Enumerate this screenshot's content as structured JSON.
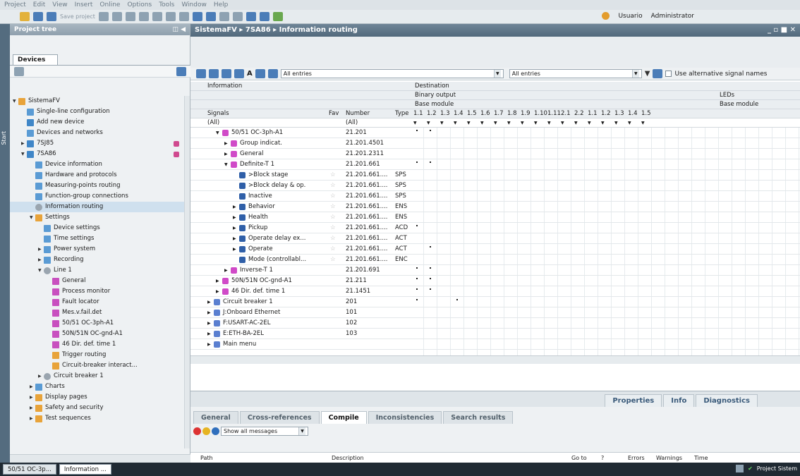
{
  "menu": [
    "Project",
    "Edit",
    "View",
    "Insert",
    "Online",
    "Options",
    "Tools",
    "Window",
    "Help"
  ],
  "toolbar": {
    "save_project": "Save project"
  },
  "user": {
    "name": "Usuario",
    "role": "Administrator"
  },
  "start_label": "Start",
  "tree": {
    "title": "Project tree",
    "tab": "Devices",
    "items": [
      {
        "label": "SistemaFV",
        "indent": 0,
        "tri": "down"
      },
      {
        "label": "Single-line configuration",
        "indent": 1
      },
      {
        "label": "Add new device",
        "indent": 1
      },
      {
        "label": "Devices and networks",
        "indent": 1
      },
      {
        "label": "7SJ85",
        "indent": 1,
        "tri": "right",
        "mark": true
      },
      {
        "label": "7SA86",
        "indent": 1,
        "tri": "down",
        "mark": true
      },
      {
        "label": "Device information",
        "indent": 2
      },
      {
        "label": "Hardware and protocols",
        "indent": 2
      },
      {
        "label": "Measuring-points routing",
        "indent": 2
      },
      {
        "label": "Function-group connections",
        "indent": 2
      },
      {
        "label": "Information routing",
        "indent": 2,
        "selected": true
      },
      {
        "label": "Settings",
        "indent": 2,
        "tri": "down"
      },
      {
        "label": "Device settings",
        "indent": 3
      },
      {
        "label": "Time settings",
        "indent": 3
      },
      {
        "label": "Power system",
        "indent": 3,
        "tri": "right"
      },
      {
        "label": "Recording",
        "indent": 3,
        "tri": "right"
      },
      {
        "label": "Line 1",
        "indent": 3,
        "tri": "down"
      },
      {
        "label": "General",
        "indent": 4
      },
      {
        "label": "Process monitor",
        "indent": 4
      },
      {
        "label": "Fault locator",
        "indent": 4
      },
      {
        "label": "Mes.v.fail.det",
        "indent": 4
      },
      {
        "label": "50/51 OC-3ph-A1",
        "indent": 4
      },
      {
        "label": "50N/51N OC-gnd-A1",
        "indent": 4
      },
      {
        "label": "46 Dir. def. time 1",
        "indent": 4
      },
      {
        "label": "Trigger routing",
        "indent": 4
      },
      {
        "label": "Circuit-breaker interact...",
        "indent": 4
      },
      {
        "label": "Circuit breaker 1",
        "indent": 3,
        "tri": "right"
      },
      {
        "label": "Charts",
        "indent": 2,
        "tri": "right"
      },
      {
        "label": "Display pages",
        "indent": 2,
        "tri": "right"
      },
      {
        "label": "Safety and security",
        "indent": 2,
        "tri": "right"
      },
      {
        "label": "Test sequences",
        "indent": 2,
        "tri": "right"
      }
    ]
  },
  "editor": {
    "breadcrumb": "SistemaFV  ▸  7SA86  ▸  Information routing",
    "filter1": "All entries",
    "filter2": "All entries",
    "alt_names": "Use alternative signal names",
    "headers": {
      "information": "Information",
      "destination": "Destination",
      "binary_output": "Binary output",
      "leds": "LEDs",
      "base_module": "Base module",
      "base_module2": "Base module",
      "signals": "Signals",
      "fav": "Fav",
      "number": "Number",
      "type": "Type",
      "all": "(All)",
      "all2": "(All)"
    },
    "columns": [
      "1.1",
      "1.2",
      "1.3",
      "1.4",
      "1.5",
      "1.6",
      "1.7",
      "1.8",
      "1.9",
      "1.10",
      "1.11",
      "2.1",
      "2.2",
      "1.1",
      "1.2",
      "1.3",
      "1.4",
      "1.5"
    ],
    "rows": [
      {
        "signal": "50/51 OC-3ph-A1",
        "indent": 1,
        "tri": "down",
        "number": "21.201",
        "type": "",
        "fav": false,
        "dots": [
          0,
          1
        ]
      },
      {
        "signal": "Group indicat.",
        "indent": 2,
        "tri": "right",
        "number": "21.201.4501",
        "type": "",
        "fav": false,
        "dots": []
      },
      {
        "signal": "General",
        "indent": 2,
        "tri": "right",
        "number": "21.201.2311",
        "type": "",
        "fav": false,
        "dots": []
      },
      {
        "signal": "Definite-T 1",
        "indent": 2,
        "tri": "down",
        "number": "21.201.661",
        "type": "",
        "fav": false,
        "dots": [
          0,
          1
        ]
      },
      {
        "signal": ">Block stage",
        "indent": 3,
        "tri": "",
        "number": "21.201.661....",
        "type": "SPS",
        "fav": true,
        "dots": []
      },
      {
        "signal": ">Block delay & op.",
        "indent": 3,
        "tri": "",
        "number": "21.201.661....",
        "type": "SPS",
        "fav": true,
        "dots": []
      },
      {
        "signal": "Inactive",
        "indent": 3,
        "tri": "",
        "number": "21.201.661....",
        "type": "SPS",
        "fav": true,
        "dots": []
      },
      {
        "signal": "Behavior",
        "indent": 3,
        "tri": "right",
        "number": "21.201.661....",
        "type": "ENS",
        "fav": true,
        "dots": []
      },
      {
        "signal": "Health",
        "indent": 3,
        "tri": "right",
        "number": "21.201.661....",
        "type": "ENS",
        "fav": true,
        "dots": []
      },
      {
        "signal": "Pickup",
        "indent": 3,
        "tri": "right",
        "number": "21.201.661....",
        "type": "ACD",
        "fav": true,
        "dots": [
          0
        ]
      },
      {
        "signal": "Operate delay ex...",
        "indent": 3,
        "tri": "right",
        "number": "21.201.661....",
        "type": "ACT",
        "fav": true,
        "dots": []
      },
      {
        "signal": "Operate",
        "indent": 3,
        "tri": "right",
        "number": "21.201.661....",
        "type": "ACT",
        "fav": true,
        "dots": [
          1
        ]
      },
      {
        "signal": "Mode (controllabl...",
        "indent": 3,
        "tri": "",
        "number": "21.201.661....",
        "type": "ENC",
        "fav": true,
        "dots": []
      },
      {
        "signal": "Inverse-T 1",
        "indent": 2,
        "tri": "right",
        "number": "21.201.691",
        "type": "",
        "fav": false,
        "dots": [
          0,
          1
        ]
      },
      {
        "signal": "50N/51N OC-gnd-A1",
        "indent": 1,
        "tri": "right",
        "number": "21.211",
        "type": "",
        "fav": false,
        "dots": [
          0,
          1
        ]
      },
      {
        "signal": "46 Dir. def. time 1",
        "indent": 1,
        "tri": "right",
        "number": "21.1451",
        "type": "",
        "fav": false,
        "dots": [
          0,
          1
        ]
      },
      {
        "signal": "Circuit breaker 1",
        "indent": 0,
        "tri": "right",
        "number": "201",
        "type": "",
        "fav": false,
        "dots": [
          0,
          3
        ]
      },
      {
        "signal": "J:Onboard Ethernet",
        "indent": 0,
        "tri": "right",
        "number": "101",
        "type": "",
        "fav": false,
        "dots": []
      },
      {
        "signal": "F:USART-AC-2EL",
        "indent": 0,
        "tri": "right",
        "number": "102",
        "type": "",
        "fav": false,
        "dots": []
      },
      {
        "signal": "E:ETH-BA-2EL",
        "indent": 0,
        "tri": "right",
        "number": "103",
        "type": "",
        "fav": false,
        "dots": []
      },
      {
        "signal": "Main menu",
        "indent": 0,
        "tri": "right",
        "number": "",
        "type": "",
        "fav": false,
        "dots": []
      }
    ]
  },
  "inspector": {
    "tabs": [
      "Properties",
      "Info",
      "Diagnostics"
    ],
    "subtabs": [
      "General",
      "Cross-references",
      "Compile",
      "Inconsistencies",
      "Search results"
    ],
    "show_messages": "Show all messages",
    "columns": [
      "Path",
      "Description",
      "Go to",
      "?",
      "Errors",
      "Warnings",
      "Time"
    ]
  },
  "taskbar": {
    "items": [
      "50/51 OC-3p...",
      "Information ..."
    ],
    "right": "Project Sistem"
  },
  "colors": {
    "accent": "#52697c",
    "selected": "#cfe0ee",
    "tree_bg": "#eef1f3"
  }
}
